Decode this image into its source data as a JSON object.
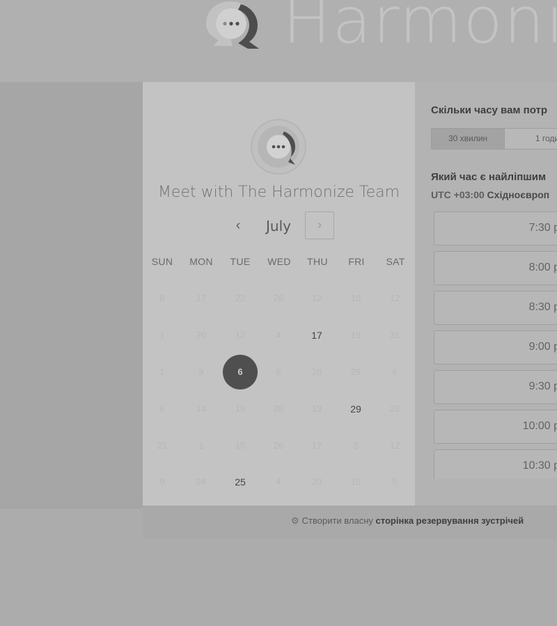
{
  "brand": {
    "name": "Harmoni",
    "logo_icon": "chat-bubble-logo-icon"
  },
  "calendar": {
    "meeting_title": "Meet with The Harmonize Team",
    "month": "July",
    "prev_glyph": "‹",
    "next_glyph": "›",
    "weekdays": [
      "SUN",
      "MON",
      "TUE",
      "WED",
      "THU",
      "FRI",
      "SAT"
    ],
    "weeks": [
      [
        {
          "d": "8",
          "s": "disabled"
        },
        {
          "d": "17",
          "s": "disabled"
        },
        {
          "d": "22",
          "s": "disabled"
        },
        {
          "d": "26",
          "s": "disabled"
        },
        {
          "d": "12",
          "s": "disabled"
        },
        {
          "d": "10",
          "s": "disabled"
        },
        {
          "d": "12",
          "s": "disabled"
        }
      ],
      [
        {
          "d": "1",
          "s": "disabled"
        },
        {
          "d": "20",
          "s": "disabled"
        },
        {
          "d": "12",
          "s": "disabled"
        },
        {
          "d": "4",
          "s": "disabled"
        },
        {
          "d": "17",
          "s": "available"
        },
        {
          "d": "19",
          "s": "disabled"
        },
        {
          "d": "31",
          "s": "disabled"
        }
      ],
      [
        {
          "d": "1",
          "s": "disabled"
        },
        {
          "d": "9",
          "s": "disabled"
        },
        {
          "d": "6",
          "s": "selected"
        },
        {
          "d": "6",
          "s": "disabled"
        },
        {
          "d": "26",
          "s": "disabled"
        },
        {
          "d": "29",
          "s": "disabled"
        },
        {
          "d": "6",
          "s": "disabled"
        }
      ],
      [
        {
          "d": "6",
          "s": "disabled"
        },
        {
          "d": "14",
          "s": "disabled"
        },
        {
          "d": "19",
          "s": "disabled"
        },
        {
          "d": "28",
          "s": "disabled"
        },
        {
          "d": "13",
          "s": "disabled"
        },
        {
          "d": "29",
          "s": "available"
        },
        {
          "d": "28",
          "s": "disabled"
        }
      ],
      [
        {
          "d": "21",
          "s": "disabled"
        },
        {
          "d": "1",
          "s": "disabled"
        },
        {
          "d": "15",
          "s": "disabled"
        },
        {
          "d": "26",
          "s": "disabled"
        },
        {
          "d": "17",
          "s": "disabled"
        },
        {
          "d": "2",
          "s": "disabled"
        },
        {
          "d": "12",
          "s": "disabled"
        }
      ],
      [
        {
          "d": "9",
          "s": "disabled"
        },
        {
          "d": "24",
          "s": "disabled"
        },
        {
          "d": "25",
          "s": "available"
        },
        {
          "d": "4",
          "s": "disabled"
        },
        {
          "d": "20",
          "s": "disabled"
        },
        {
          "d": "15",
          "s": "disabled"
        },
        {
          "d": "5",
          "s": "disabled"
        }
      ]
    ]
  },
  "times": {
    "duration_question": "Скільки часу вам потр",
    "duration_options": [
      {
        "label": "30 хвилин",
        "active": true
      },
      {
        "label": "1 годи",
        "active": false
      }
    ],
    "time_question": "Який час є найліпшим",
    "timezone_offset": "UTC +03:00",
    "timezone_name": "Східноєвроп",
    "slots": [
      "7:30 p",
      "8:00 p",
      "8:30 p",
      "9:00 p",
      "9:30 p",
      "10:00 p",
      "10:30 p"
    ]
  },
  "footer": {
    "prefix": "Створити власну",
    "link_bold": "сторінка резервування зустрічей",
    "sprocket_glyph": "⚙"
  }
}
